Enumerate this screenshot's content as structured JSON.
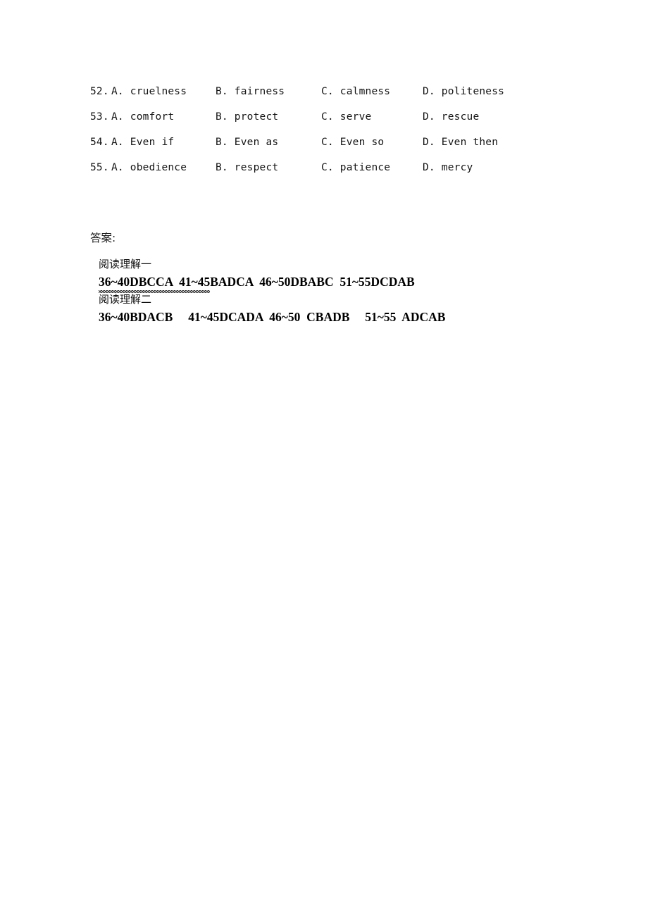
{
  "document": {
    "background_color": "#ffffff",
    "text_color": "#000000"
  },
  "questions": [
    {
      "number": "52.",
      "a": "A. cruelness",
      "b": "B. fairness",
      "c": "C. calmness",
      "d": "D. politeness"
    },
    {
      "number": "53.",
      "a": "A. comfort",
      "b": "B. protect",
      "c": "C. serve",
      "d": "D. rescue"
    },
    {
      "number": "54.",
      "a": "A. Even if",
      "b": "B. Even as",
      "c": "C. Even so",
      "d": "D. Even then"
    },
    {
      "number": "55.",
      "a": "A. obedience",
      "b": "B. respect",
      "c": "C. patience",
      "d": "D. mercy"
    }
  ],
  "answers": {
    "label": "答案:",
    "sections": [
      {
        "heading": "阅读理解一",
        "line_marked": "36~40DBCCA  41~45",
        "line_rest": "BADCA  46~50DBABC  51~55DCDAB",
        "full_line": "36~40DBCCA  41~45BADCA  46~50DBABC  51~55DCDAB"
      },
      {
        "heading": "阅读理解二",
        "full_line": "36~40BDACB     41~45DCADA  46~50  CBADB     51~55  ADCAB"
      }
    ]
  }
}
